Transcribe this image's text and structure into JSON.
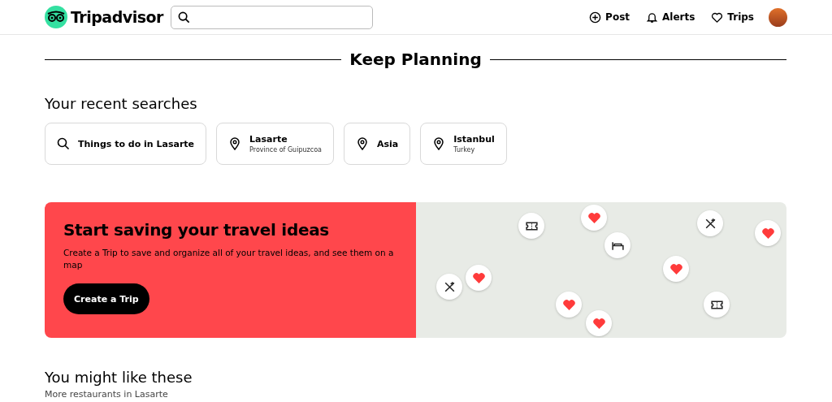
{
  "header": {
    "logo": "Tripadvisor",
    "nav": [
      {
        "kind": "post",
        "label": "Post"
      },
      {
        "kind": "alerts",
        "label": "Alerts"
      },
      {
        "kind": "trips",
        "label": "Trips"
      }
    ]
  },
  "heading": "Keep Planning",
  "recent_searches": {
    "title": "Your recent searches",
    "items": [
      {
        "kind": "search",
        "title": "Things to do in Lasarte"
      },
      {
        "kind": "place",
        "title": "Lasarte",
        "subtitle": "Province of Guipuzcoa"
      },
      {
        "kind": "place",
        "title": "Asia"
      },
      {
        "kind": "place",
        "title": "Istanbul",
        "subtitle": "Turkey"
      }
    ]
  },
  "banner": {
    "title": "Start saving your travel ideas",
    "text": "Create a Trip to save and organize all of your travel ideas, and see them on a map",
    "button": "Create a Trip"
  },
  "suggestions": {
    "title": "You might like these",
    "subtitle": "More restaurants in Lasarte"
  }
}
